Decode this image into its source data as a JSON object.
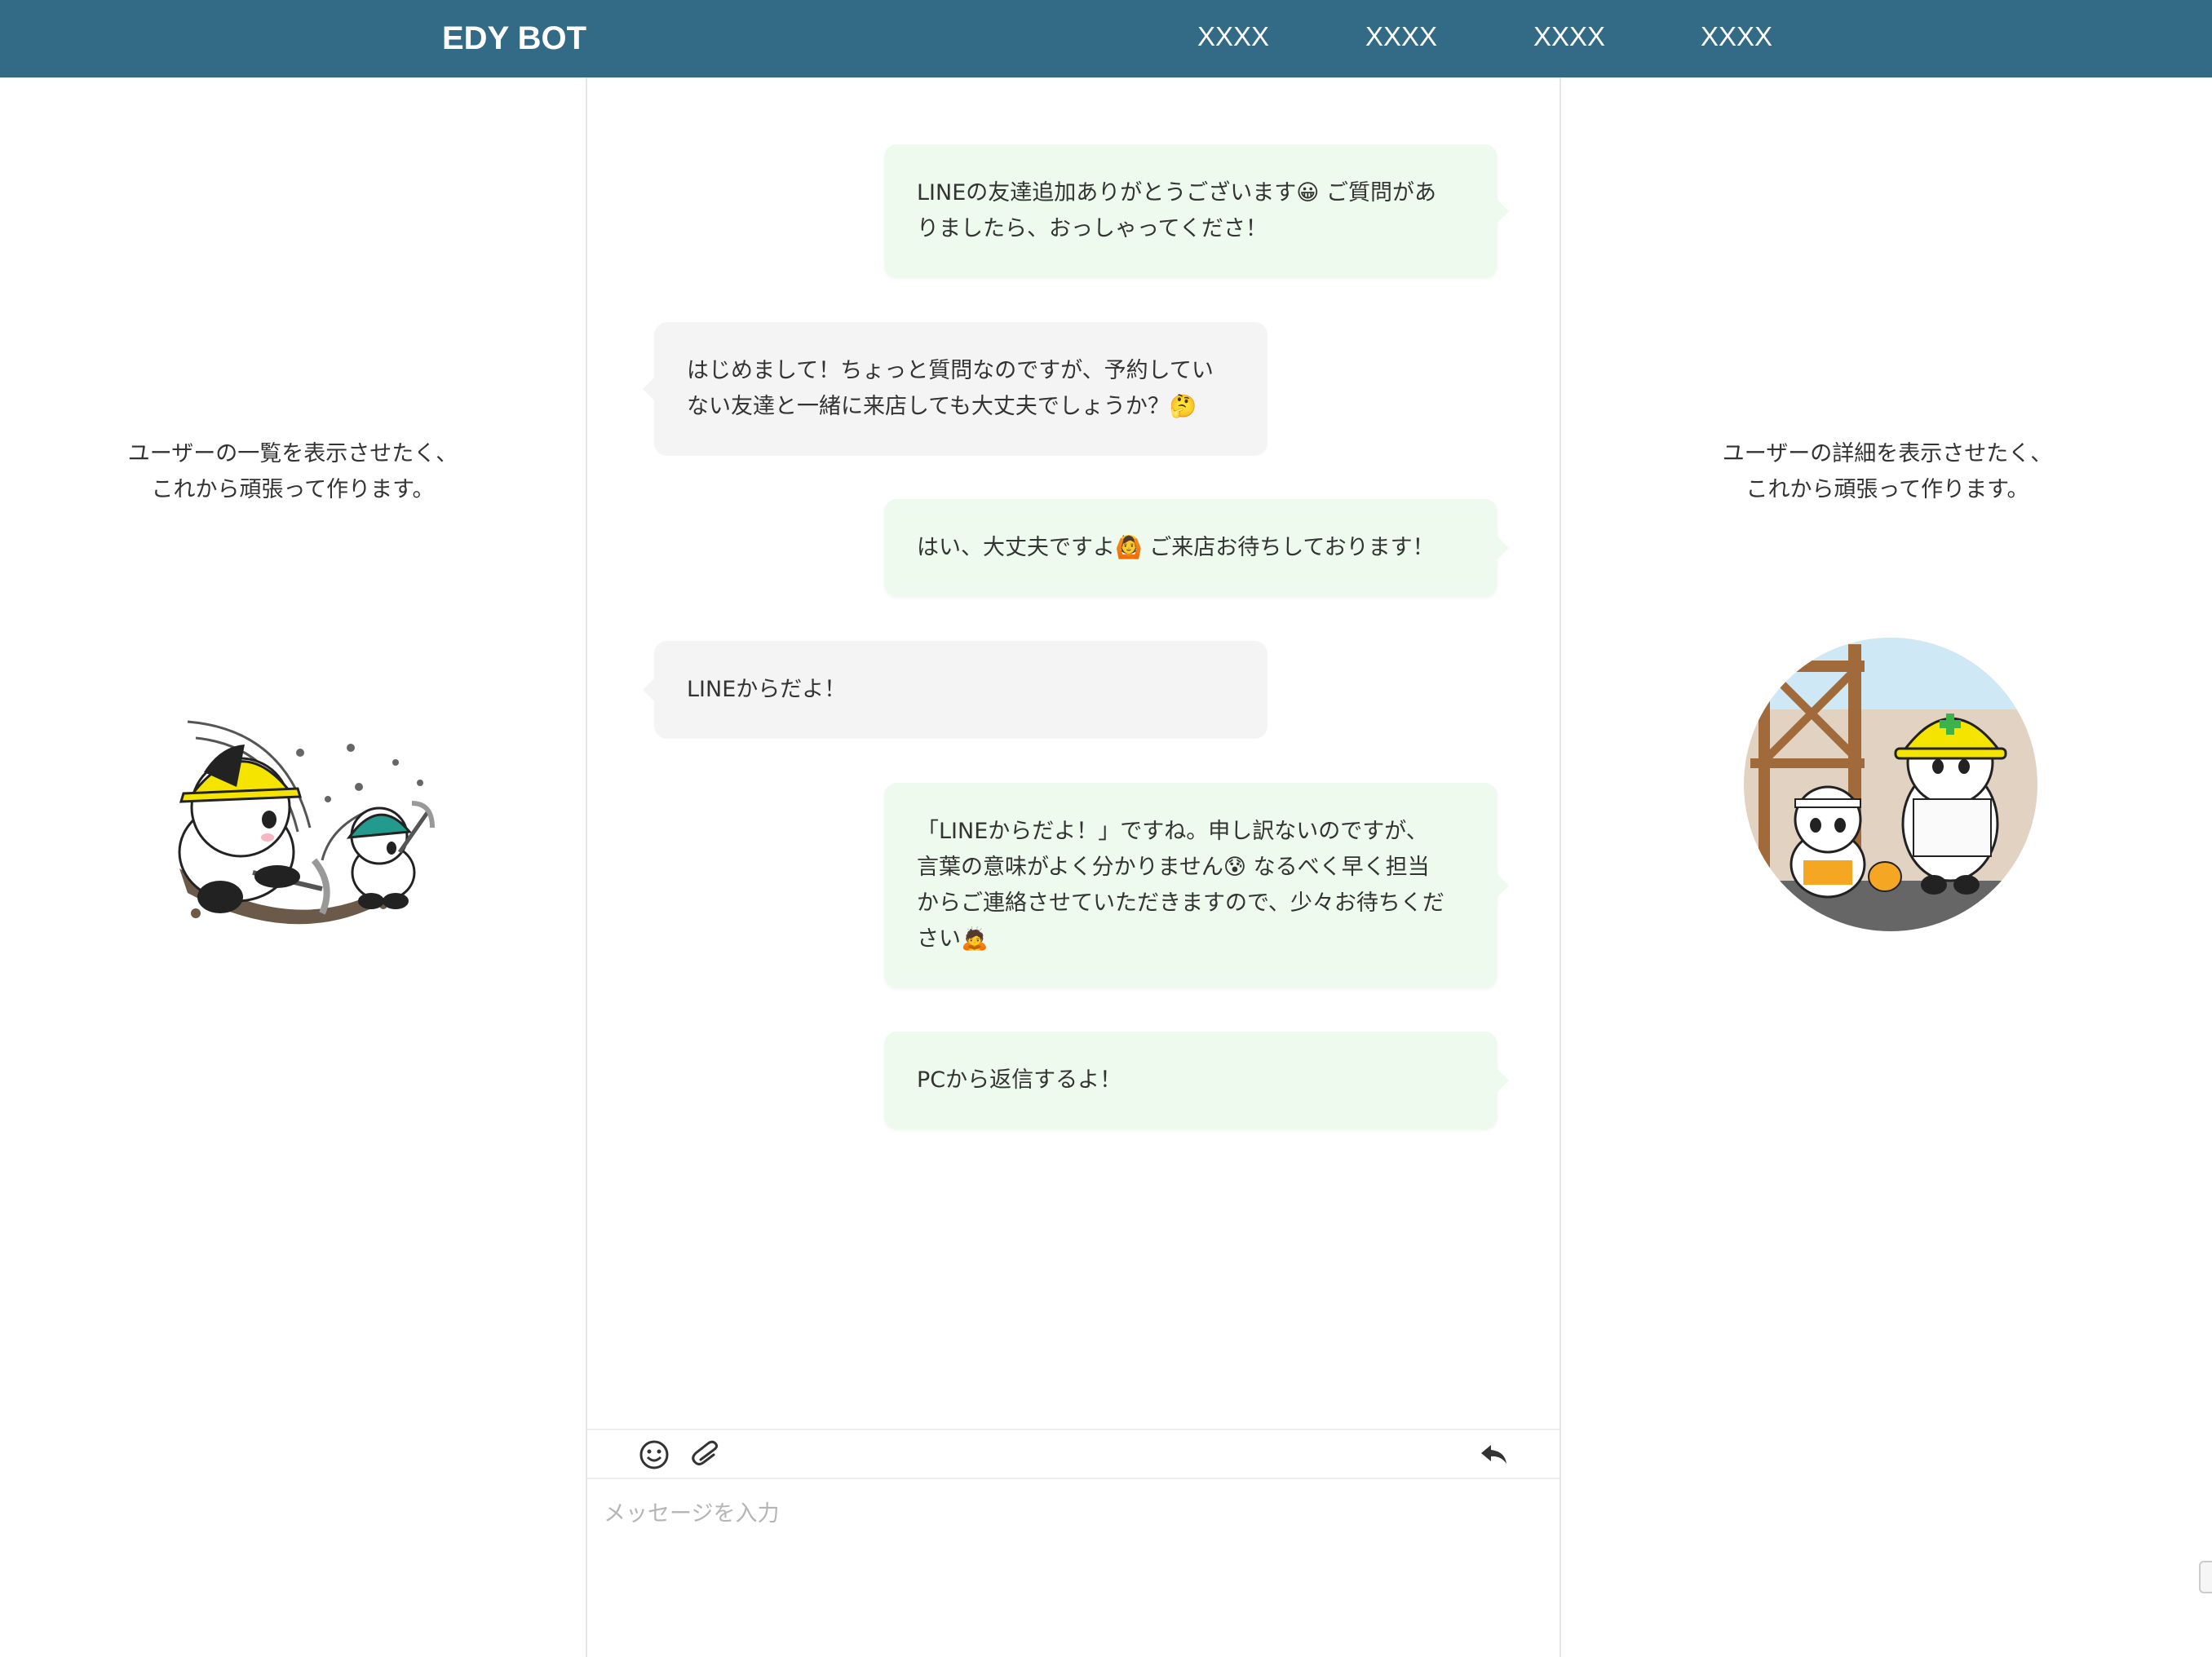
{
  "header": {
    "brand": "EDY BOT",
    "nav": [
      "XXXX",
      "XXXX",
      "XXXX",
      "XXXX"
    ],
    "color": "#336b86"
  },
  "left_panel": {
    "lines": [
      "ユーザーの一覧を表示させたく、",
      "これから頑張って作ります。"
    ]
  },
  "right_panel": {
    "lines": [
      "ユーザーの詳細を表示させたく、",
      "これから頑張って作ります。"
    ]
  },
  "chat": {
    "messages": [
      {
        "from": "bot",
        "lines": [
          "LINEの友達追加ありがとうございます😀 ご質問があ",
          "りましたら、おっしゃってくださ！"
        ]
      },
      {
        "from": "user",
        "lines": [
          "はじめまして！ちょっと質問なのですが、予約してい",
          "ない友達と一緒に来店しても大丈夫でしょうか？🤔"
        ]
      },
      {
        "from": "bot",
        "lines": [
          "はい、大丈夫ですよ🙆 ご来店お待ちしております！"
        ]
      },
      {
        "from": "user",
        "lines": [
          "LINEからだよ！"
        ]
      },
      {
        "from": "bot",
        "lines": [
          "「LINEからだよ！」ですね。申し訳ないのですが、",
          "言葉の意味がよく分かりません😰 なるべく早く担当",
          "からご連絡させていただきますので、少々お待ちくだ",
          "さい🙇"
        ]
      },
      {
        "from": "bot",
        "lines": [
          "PCから返信するよ！"
        ]
      }
    ],
    "bubble_colors": {
      "bot": "#eefaed",
      "user": "#f4f4f4"
    }
  },
  "composer": {
    "placeholder": "メッセージを入力",
    "icons": [
      "emoji-icon",
      "attachment-icon",
      "reply-icon"
    ]
  }
}
